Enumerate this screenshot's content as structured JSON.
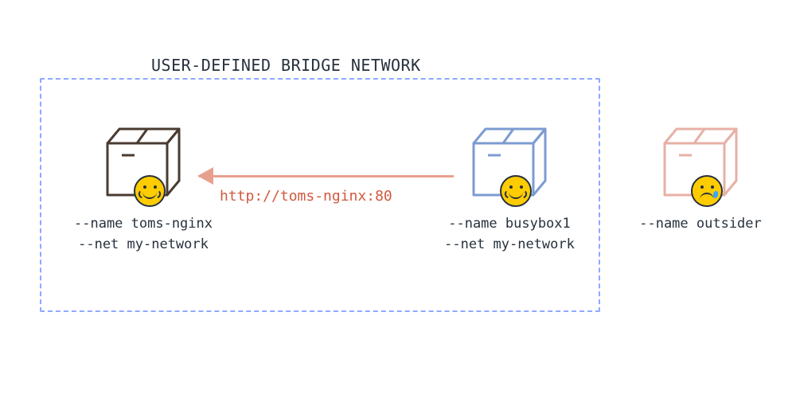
{
  "title": "USER-DEFINED BRIDGE NETWORK",
  "arrow_label": "http://toms-nginx:80",
  "nodes": {
    "left": {
      "name": "--name toms-nginx",
      "net": "--net my-network"
    },
    "mid": {
      "name": "--name busybox1",
      "net": "--net my-network"
    },
    "right": {
      "name": "--name outsider",
      "net": ""
    }
  },
  "colors": {
    "left": "#4a3b30",
    "mid": "#7c9bd1",
    "right": "#e7b0a6"
  }
}
